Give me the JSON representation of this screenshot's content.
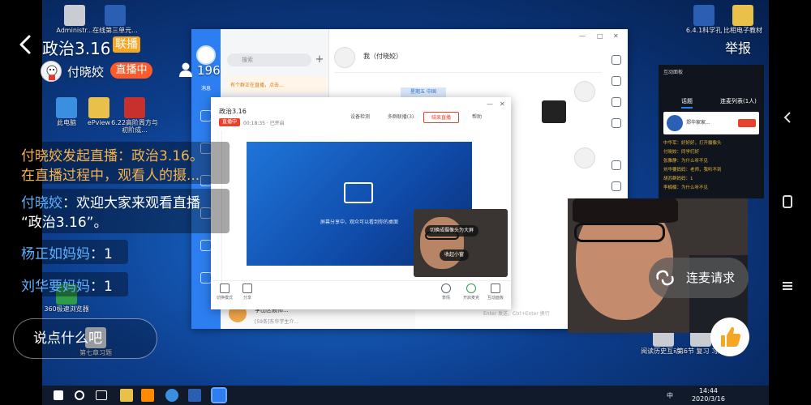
{
  "header": {
    "title": "政治3.16",
    "lianbo_badge": "联播",
    "host_name": "付晓姣",
    "live_badge": "直播中",
    "viewer_count": "196",
    "report": "举报"
  },
  "comments": [
    {
      "line1": "付晓姣发起直播：政治3.16。",
      "line2": "在直播过程中，观看人的摄..."
    },
    {
      "user": "付晓姣",
      "line1": "：欢迎大家来观看直播",
      "line2": "“政治3.16”。"
    },
    {
      "user": "杨正如妈妈",
      "text": "：1"
    },
    {
      "user": "刘华要妈妈",
      "text": "：1"
    }
  ],
  "input": {
    "placeholder": "说点什么吧"
  },
  "lianmai": {
    "label": "连麦请求"
  },
  "desktop": {
    "icons_left": [
      {
        "label": "Administr..."
      },
      {
        "label": "在线第三单元..."
      },
      {
        "label": "此电脑"
      },
      {
        "label": "ePview"
      },
      {
        "label": "6.22高阶周方与初阶成..."
      },
      {
        "label": "360极速浏览器"
      },
      {
        "label": "第七章习题"
      }
    ],
    "icons_right": [
      {
        "label": "6.4.1科学孔"
      },
      {
        "label": "比相电子教材"
      },
      {
        "label": "阅读历史互动..."
      },
      {
        "label": "第6节 复习 习题"
      }
    ],
    "clock_time": "14:44",
    "clock_date": "2020/3/16",
    "tray_text": "中"
  },
  "main_window": {
    "search_placeholder": "搜索",
    "notice": "有个群正在直播，点击...",
    "chat_name": "我（付晓姣）",
    "date_bubble": "星期五 中国",
    "nav_label": "消息",
    "contacts": [
      {
        "name": "李山区教师...",
        "message": "[59条]东华学生介..."
      }
    ],
    "footer_text": "Enter 发送，Ctrl+Enter 换行"
  },
  "live_window": {
    "title": "政治3.16",
    "live_badge": "直播中",
    "time": "00:18:35",
    "status": "已开启",
    "buttons": {
      "check": "设备检测",
      "multi": "多群联播(3)",
      "end": "结束直播",
      "help": "帮助"
    },
    "screen_text": "屏幕分享中，观众可以看到你的桌面",
    "pill_fullscreen": "切换成摄像头为大屏",
    "pill_shrink": "收起小窗",
    "tools_left": [
      {
        "label": "切换模式"
      },
      {
        "label": "分享"
      }
    ],
    "tools_right": [
      {
        "label": "表情"
      },
      {
        "label": "开启麦克"
      },
      {
        "label": "互动面板"
      }
    ]
  },
  "panel": {
    "title": "互动面板",
    "tabs": [
      "话题",
      "连麦列表(1人)"
    ],
    "card_name": "郑华家家...",
    "messages": [
      "中华军：好好好，打开摄像头",
      "付晓姣：同学们好",
      "张雅静：为什么听不见",
      "刘华要妈妈：老师，我听不到",
      "胡苏群妈妈：1",
      "李楠楠：为什么听不见"
    ]
  },
  "colors": {
    "live_orange": "#ff5a2a",
    "lianbo_orange": "#f5a623",
    "user_blue": "#5fb0ff",
    "system_orange": "#f7b24a",
    "app_blue": "#2d7ef0"
  },
  "icons": {
    "back": "chevron-left-icon",
    "viewers": "person-icon",
    "lianmai": "link-icon",
    "like": "thumbs-up-icon"
  }
}
